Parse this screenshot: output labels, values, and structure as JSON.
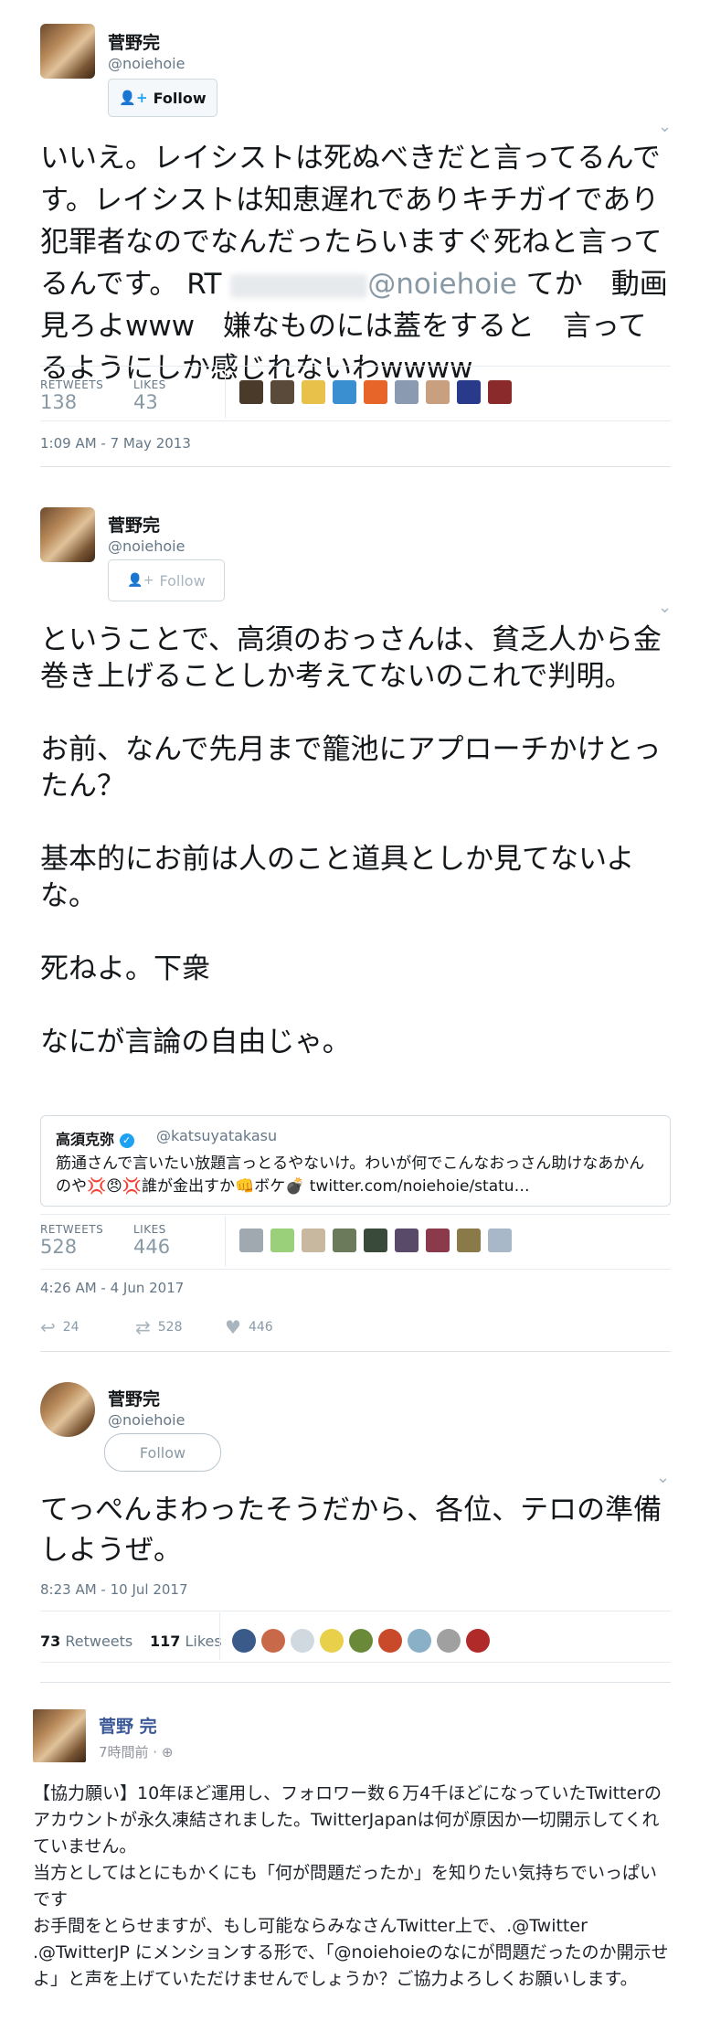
{
  "tweet1": {
    "name": "菅野完",
    "handle": "@noiehoie",
    "follow_label": "Follow",
    "text_before": "いいえ。レイシストは死ぬべきだと言ってるんです。レイシストは知恵遅れでありキチガイであり犯罪者なのでなんだったらいますぐ死ねと言ってるんです。 RT ",
    "mention": "@noiehoie",
    "text_after": " てか　動画見ろよwww　嫌なものには蓋をすると　言ってるようにしか感じれないわwwww",
    "retweets_label": "RETWEETS",
    "retweets": "138",
    "likes_label": "LIKES",
    "likes": "43",
    "timestamp": "1:09 AM - 7 May 2013",
    "liker_colors": [
      "#4a3a2a",
      "#5a4a3a",
      "#e8c14a",
      "#3a8fd0",
      "#e8652a",
      "#8a9ab0",
      "#c8a080",
      "#2a3a8a",
      "#8a2a2a"
    ]
  },
  "tweet2": {
    "name": "菅野完",
    "handle": "@noiehoie",
    "follow_label": "Follow",
    "text": "ということで、高須のおっさんは、貧乏人から金巻き上げることしか考えてないのこれで判明。\n\nお前、なんで先月まで籠池にアプローチかけとったん？\n\n基本的にお前は人のこと道具としか見てないよな。\n\n死ねよ。下衆\n\nなにが言論の自由じゃ。",
    "quote": {
      "name": "高須克弥",
      "handle": "@katsuyatakasu",
      "line1": "筋通さんで言いたい放題言っとるやないけ。わいが何でこんなおっさん助けなあかん",
      "line2": "のや💢😠💢誰が金出すか👊ボケ💣 twitter.com/noiehoie/statu…"
    },
    "retweets_label": "RETWEETS",
    "retweets": "528",
    "likes_label": "LIKES",
    "likes": "446",
    "timestamp": "4:26 AM - 4 Jun 2017",
    "reply_count": "24",
    "retweet_count": "528",
    "like_count": "446",
    "liker_colors": [
      "#a0a8b0",
      "#9ad07a",
      "#c8b8a0",
      "#6a7a5a",
      "#3a4a3a",
      "#5a4a6a",
      "#8a3a4a",
      "#8a7a4a",
      "#a8b8c8"
    ]
  },
  "tweet3": {
    "name": "菅野完",
    "handle": "@noiehoie",
    "follow_label": "Follow",
    "text": "てっぺんまわったそうだから、各位、テロの準備しようぜ。",
    "timestamp": "8:23 AM - 10 Jul 2017",
    "retweets_count": "73",
    "retweets_word": "Retweets",
    "likes_count": "117",
    "likes_word": "Likes",
    "liker_colors": [
      "#3a5a8a",
      "#c86a4a",
      "#d0d8e0",
      "#e8d04a",
      "#6a8a3a",
      "#c84a2a",
      "#8ab0c8",
      "#a0a0a0",
      "#b02a2a"
    ]
  },
  "fb_post": {
    "name": "菅野 完",
    "meta": "7時間前 · ⊕",
    "text": "【協力願い】10年ほど運用し、フォロワー数６万4千ほどになっていたTwitterのアカウントが永久凍結されました。TwitterJapanは何が原因か一切開示してくれていません。\n当方としてはとにもかくにも「何が問題だったか」を知りたい気持ちでいっぱいです\nお手間をとらせますが、もし可能ならみなさんTwitter上で、.@Twitter .@TwitterJP にメンションする形で、「@noiehoieのなにが問題だったのか開示せよ」と声を上げていただけませんでしょうか？ご協力よろしくお願いします。"
  }
}
